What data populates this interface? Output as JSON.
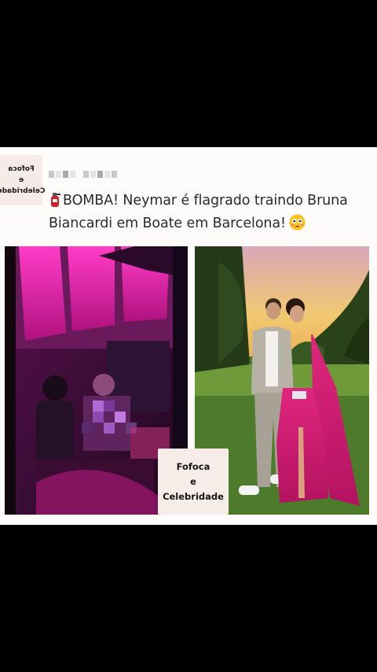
{
  "post": {
    "badge": {
      "line1": "Fofoca",
      "line2": "e",
      "line3": "Celebridade"
    },
    "headline": "BOMBA! Neymar é flagrado traindo Bruna Biancardi em Boate em Barcelona!",
    "headline_leading_emoji": "fire-extinguisher-icon",
    "headline_trailing_emoji": "flushed-face-icon",
    "images": [
      {
        "name": "club-photo",
        "alt": ""
      },
      {
        "name": "couple-photo",
        "alt": ""
      }
    ],
    "watermark": {
      "line1": "Fofoca",
      "line2": "e",
      "line3": "Celebridade"
    }
  },
  "colors": {
    "background": "#000000",
    "card": "#fdfcfa",
    "accent_pink": "#e0239a",
    "dress": "#d81c74"
  }
}
